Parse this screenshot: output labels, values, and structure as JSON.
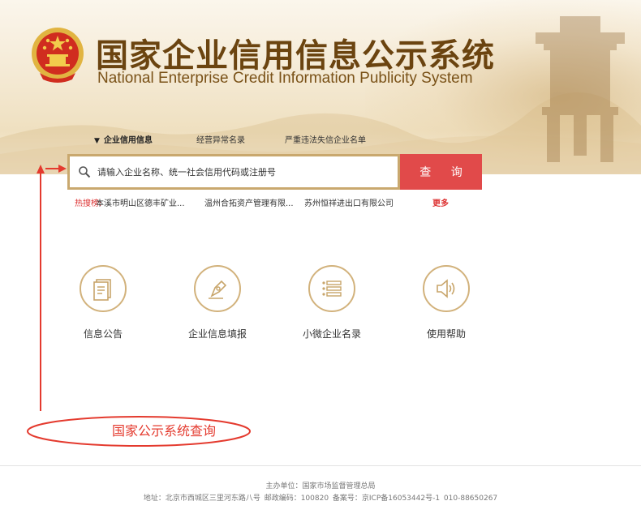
{
  "header": {
    "title_cn": "国家企业信用信息公示系统",
    "title_en": "National Enterprise Credit Information Publicity System"
  },
  "tabs": [
    {
      "label": "企业信用信息",
      "active": true
    },
    {
      "label": "经营异常名录",
      "active": false
    },
    {
      "label": "严重违法失信企业名单",
      "active": false
    }
  ],
  "search": {
    "placeholder": "请输入企业名称、统一社会信用代码或注册号",
    "button_label": "查 询"
  },
  "hot_search": {
    "label": "热搜榜:",
    "items": [
      "本溪市明山区德丰矿业...",
      "温州合拓资产管理有限...",
      "苏州恒祥进出口有限公司"
    ],
    "more_label": "更多"
  },
  "features": [
    {
      "label": "信息公告",
      "icon": "document-icon"
    },
    {
      "label": "企业信息填报",
      "icon": "pen-nib-icon"
    },
    {
      "label": "小微企业名录",
      "icon": "list-icon"
    },
    {
      "label": "使用帮助",
      "icon": "speaker-icon"
    }
  ],
  "annotation": {
    "text": "国家公示系统查询",
    "color": "#e43a2e"
  },
  "footer": {
    "sponsor": "主办单位：国家市场监督管理总局",
    "address": "地址：北京市西城区三里河东路八号   邮政编码：100820   备案号：京ICP备16053442号-1   010-88650267"
  },
  "colors": {
    "brand_brown": "#6b4410",
    "gold_border": "#c9a86e",
    "search_red": "#e14a4a",
    "hot_red": "#dd3333"
  }
}
